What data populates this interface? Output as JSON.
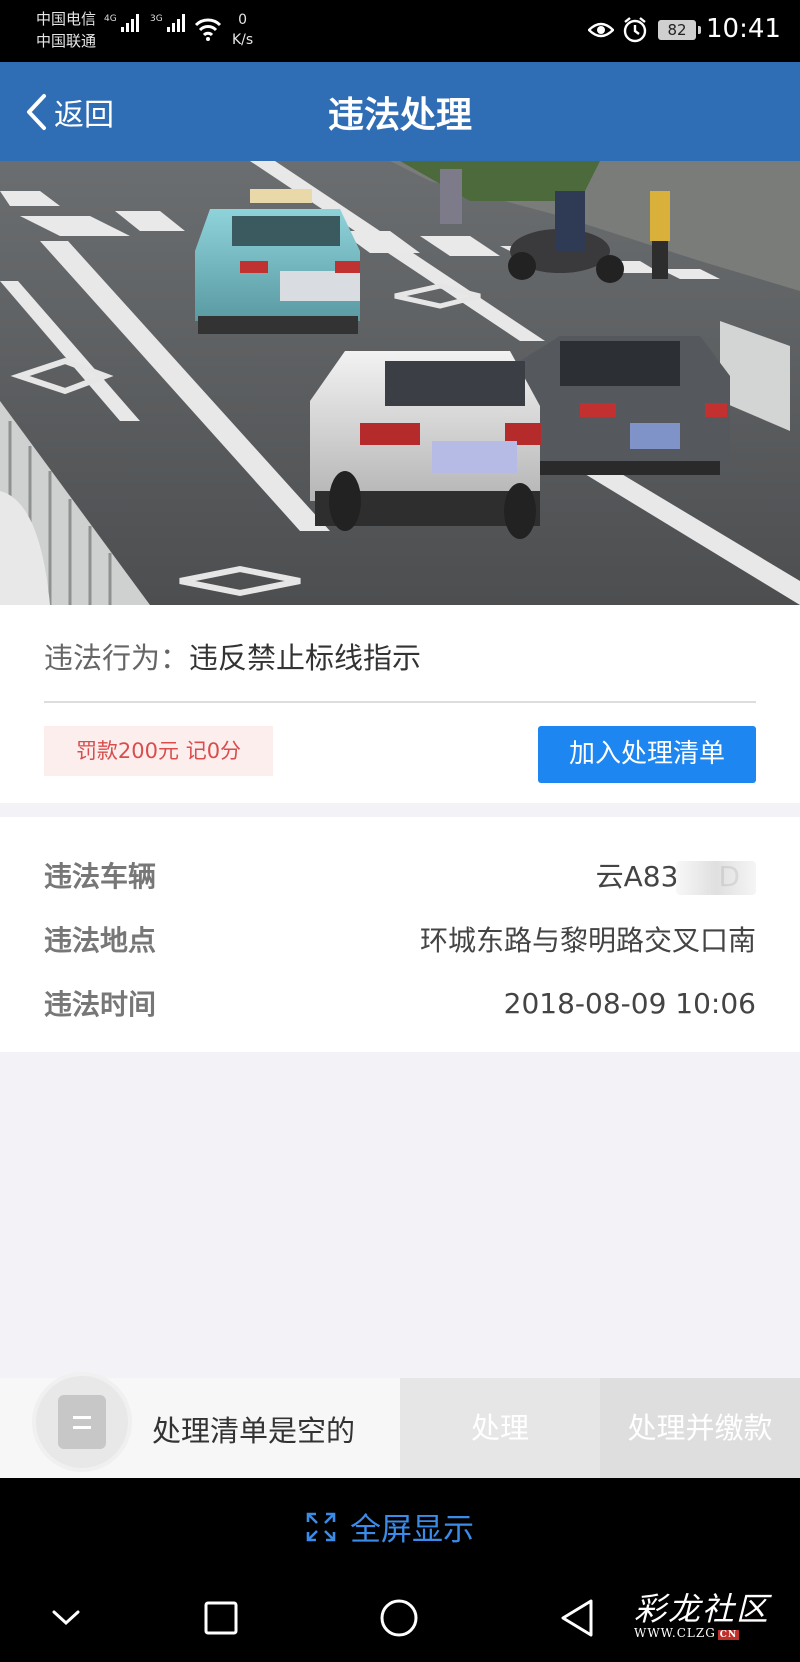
{
  "status_bar": {
    "carrier_1": "中国电信",
    "carrier_2": "中国联通",
    "network_1": "4G",
    "network_2": "3G",
    "net_speed": "0",
    "net_speed_unit": "K/s",
    "battery": "82",
    "time": "10:41"
  },
  "header": {
    "back_label": "返回",
    "title": "违法处理"
  },
  "photo": {
    "image_count": 3,
    "active_index": 1
  },
  "violation": {
    "behavior_label": "违法行为：",
    "behavior_value": "违反禁止标线指示",
    "penalty": "罚款200元 记0分",
    "add_button": "加入处理清单"
  },
  "details": {
    "vehicle_label": "违法车辆",
    "vehicle_value": "云A83",
    "vehicle_value_tail": "D",
    "location_label": "违法地点",
    "location_value": "环城东路与黎明路交叉口南",
    "time_label": "违法时间",
    "time_value": "2018-08-09 10:06"
  },
  "bottom_bar": {
    "empty_text": "处理清单是空的",
    "process_button": "处理",
    "process_pay_button": "处理并缴款"
  },
  "fullscreen": {
    "label": "全屏显示"
  },
  "watermark": {
    "title": "彩龙社区",
    "url": "WWW.CLZG",
    "url_suffix": "CN"
  },
  "colors": {
    "app_bar": "#2f6db5",
    "primary_button": "#1e86f0",
    "penalty_text": "#d94d4d",
    "penalty_bg": "#fdeeee"
  }
}
